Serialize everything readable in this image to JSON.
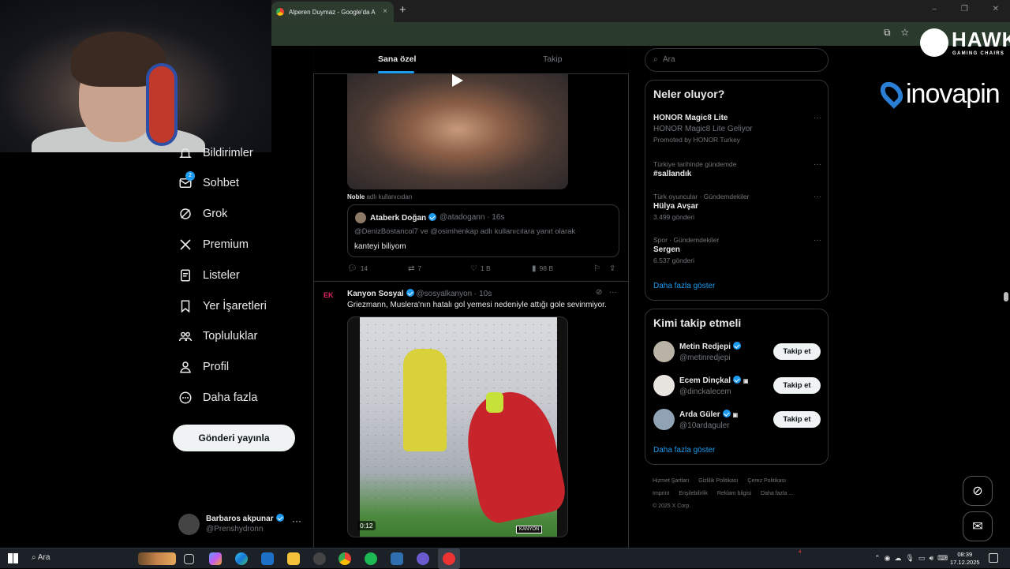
{
  "browser": {
    "tab_title": "Alperen Duymaz - Google'da A",
    "tab_close": "×",
    "new_tab": "+"
  },
  "nav": {
    "items": [
      {
        "label": "Bildirimler",
        "icon": "bell-icon"
      },
      {
        "label": "Sohbet",
        "icon": "mail-icon",
        "badge": "2"
      },
      {
        "label": "Grok",
        "icon": "grok-icon"
      },
      {
        "label": "Premium",
        "icon": "x-logo-icon"
      },
      {
        "label": "Listeler",
        "icon": "list-icon"
      },
      {
        "label": "Yer İşaretleri",
        "icon": "bookmark-icon"
      },
      {
        "label": "Topluluklar",
        "icon": "communities-icon"
      },
      {
        "label": "Profil",
        "icon": "profile-icon"
      },
      {
        "label": "Daha fazla",
        "icon": "more-circle-icon"
      }
    ],
    "post_button": "Gönderi yayınla",
    "account": {
      "name": "Barbaros akpunar",
      "handle": "@Prenshydronn",
      "more": "···"
    }
  },
  "feed": {
    "tabs": [
      "Sana özel",
      "Takip"
    ],
    "post1": {
      "context_user": "Noble",
      "context_text": "adlı kullanıcıdan",
      "quote": {
        "name": "Ataberk Doğan",
        "handle": "@atadogann · 16s",
        "reply_to": "@DenizBostancol7 ve @osimhenkap adlı kullanıcılara yanıt olarak",
        "text": "kanteyi biliyom"
      },
      "metrics": {
        "replies": "14",
        "reposts": "7",
        "likes": "1 B",
        "views": "98 B"
      }
    },
    "post2": {
      "avatar_text": "EK",
      "name": "Kanyon Sosyal",
      "handle": "@sosyalkanyon · 10s",
      "text": "Griezmann, Muslera'nın hatalı gol yemesi nedeniyle attığı gole sevinmiyor.",
      "video_time": "0:12",
      "video_watermark": "KANYON"
    }
  },
  "sidebar": {
    "search_placeholder": "Ara",
    "trends_title": "Neler oluyor?",
    "trends": [
      {
        "line1": "HONOR Magic8 Lite",
        "line2": "HONOR Magic8 Lite Geliyor",
        "line3": "Promoted by HONOR Turkey"
      },
      {
        "line1": "Türkiye tarihinde gündemde",
        "line2": "#sallandık",
        "line3": ""
      },
      {
        "line1": "Türk oyuncular · Gündemdekiler",
        "line2": "Hülya Avşar",
        "line3": "3.499 gönderi"
      },
      {
        "line1": "Spor · Gündemdekiler",
        "line2": "Sergen",
        "line3": "6.537 gönderi"
      }
    ],
    "trends_show_more": "Daha fazla göster",
    "follow_title": "Kimi takip etmeli",
    "follow": [
      {
        "name": "Metin Redjepi",
        "handle": "@metinredjepi",
        "button": "Takip et",
        "avatar_color": "#b9b3a5"
      },
      {
        "name": "Ecem Dinçkal",
        "handle": "@dinckalecem",
        "button": "Takip et",
        "avatar_color": "#e8e4e0"
      },
      {
        "name": "Arda Güler",
        "handle": "@10ardaguler",
        "button": "Takip et",
        "avatar_color": "#8fa3b4"
      }
    ],
    "follow_show_more": "Daha fazla göster",
    "footer": [
      "Hizmet Şartları",
      "Gizlilik Politikası",
      "Çerez Politikası",
      "Imprint",
      "Erişilebilirlik",
      "Reklam bilgisi",
      "Daha fazla ...",
      "© 2025 X Corp."
    ]
  },
  "overlay": {
    "hawk_title": "HAWK",
    "hawk_sub": "GAMING CHAIRS",
    "inova": "inovapin"
  },
  "taskbar": {
    "search": "Ara",
    "time": "08:39",
    "date": "17.12.2025",
    "badge": "4"
  },
  "colors": {
    "accent": "#1d9bf0",
    "background": "#000000",
    "border": "#2f3336",
    "muted": "#71767b"
  }
}
